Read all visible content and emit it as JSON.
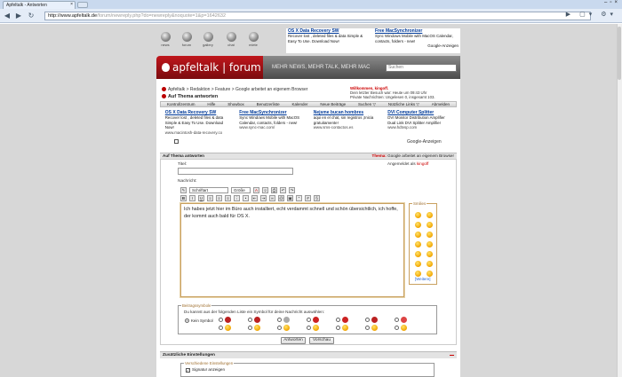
{
  "browser": {
    "tab_title": "Apfeltalk - Antworten",
    "url_host": "http://www.apfeltalk.de",
    "url_path": "/forum/newreply.php?do=newreply&noquote=1&p=1642632"
  },
  "site": {
    "top_icons": [
      "news",
      "forum",
      "gallery",
      "chat",
      "miete"
    ],
    "logo_text": "apfeltalk | forum",
    "slogan": "MEHR NEWS, MEHR TALK, MEHR MAC",
    "search_placeholder": "Suchen"
  },
  "top_ads": [
    {
      "title": "OS X Data Recovery SW",
      "text": "Recover lost , deleted files & data Simple & Easy To Use. Download Now!"
    },
    {
      "title": "Free MacSynchronizer",
      "text": "Sync Windows Mobile with MacOS Calendar, contacts, folders - new!"
    }
  ],
  "google_ads_label": "Google-Anzeigen",
  "breadcrumb": "Apfeltalk > Redaktion > Feature > Google arbeitet an eigenem Browser",
  "page_title": "Auf Thema antworten",
  "welcome": {
    "line1": "Willkommen,",
    "user": "kingoff.",
    "line2": "Dein letzter Besuch war: Heute um 09:43 Uhr",
    "line3": "Private Nachrichten: Ungelesen 0, insgesamt 103."
  },
  "nav": [
    "Kontrollzentrum",
    "Hilfe",
    "Showbox",
    "Benutzerliste",
    "Kalender",
    "Neue Beiträge",
    "Suchen ▽",
    "Nützliche Links ▽",
    "Abmelden"
  ],
  "mid_ads": [
    {
      "title": "OS X Data Recovery SW",
      "text": "Recover lost , deleted files & data Simple & Easy To Use. Download Now!",
      "url": "www.macintosh-data-recovery.co"
    },
    {
      "title": "Free MacSynchronizer",
      "text": "Sync Windows Mobile with MacOS Calendar, contacts, folders - new!",
      "url": "www.sync-mac.com/"
    },
    {
      "title": "Nejsme bucan hombres",
      "text": "aqui en el chat, sin registros ¡Inicia gratuitamente!",
      "url": "www.sms-contactos.es"
    },
    {
      "title": "DVI Computer Splitter",
      "text": "DVI Monitor Distribution Amplifier Dual Link DVI Splitter Amplifier",
      "url": "www.hdtvsp.com"
    }
  ],
  "form": {
    "header": "Auf Thema antworten",
    "thema_label": "Thema:",
    "thema_value": "Google arbeitet an eigenem Browser",
    "title_label": "Titel:",
    "logged_in_label": "Angemeldet als",
    "logged_in_user": "kingoff",
    "message_label": "Nachricht:",
    "font_select": "Schriftart",
    "size_select": "Größe",
    "message_text": "Ich habes jetzt hier im Büro auch installiert, echt verdammt schnell und schön übersichtlich, ich hoffe, der kommt auch bald für OS X.",
    "smilies_legend": "Smilies",
    "more_smilies": "[Weitere]",
    "symbols_legend": "Beitragssymbole",
    "symbols_text": "Du kannst aus der folgenden Liste ein Symbol für deine Nachricht auswählen:",
    "no_symbol": "Kein Symbol",
    "submit": "Antworten",
    "preview": "Vorschau"
  },
  "extra": {
    "header": "Zusätzliche Einstellungen",
    "misc_legend": "Verschiedene Einstellungen",
    "signature": "Signatur anzeigen"
  }
}
